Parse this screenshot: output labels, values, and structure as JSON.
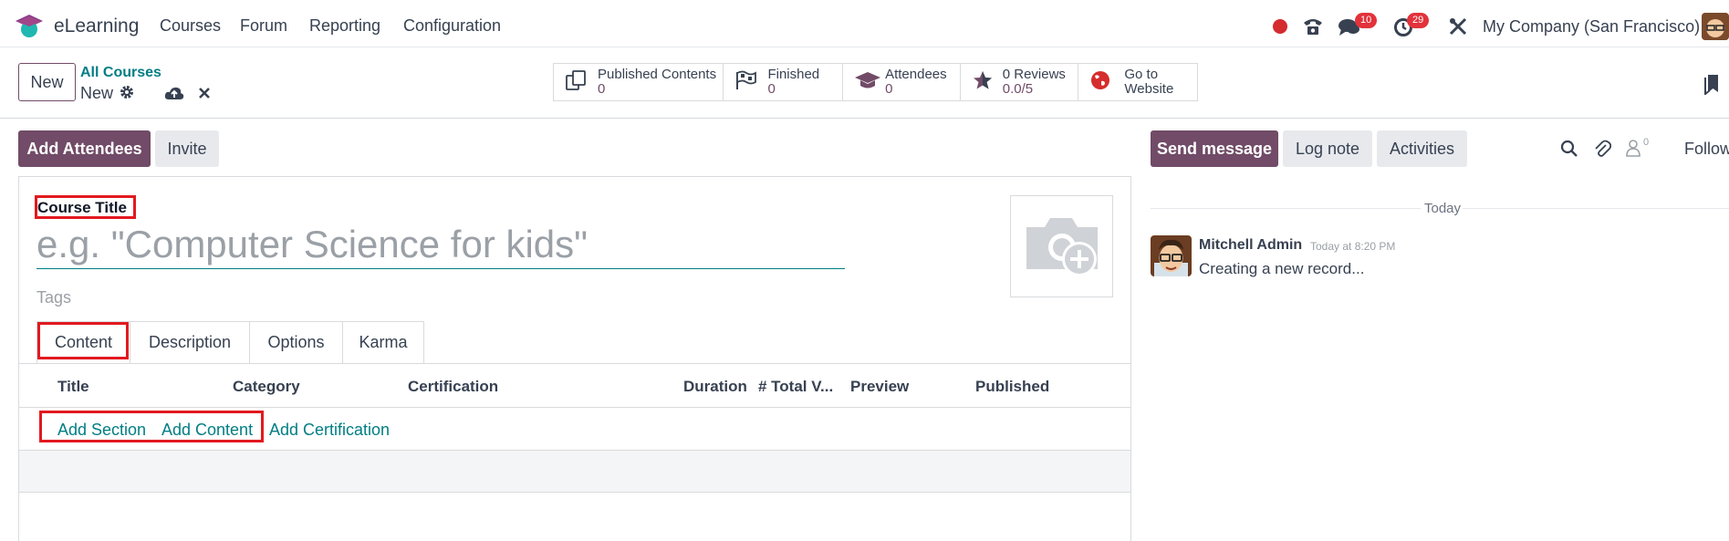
{
  "topbar": {
    "app_name": "eLearning",
    "menus": [
      "Courses",
      "Forum",
      "Reporting",
      "Configuration"
    ],
    "messages_count": "10",
    "activities_count": "29",
    "company": "My Company (San Francisco)"
  },
  "control_panel": {
    "new_label": "New",
    "breadcrumb_parent": "All Courses",
    "breadcrumb_current": "New",
    "stats": [
      {
        "label": "Published Contents",
        "value": "0",
        "icon": "copy-icon"
      },
      {
        "label": "Finished",
        "value": "0",
        "icon": "flag-icon"
      },
      {
        "label": "Attendees",
        "value": "0",
        "icon": "graduation-cap-icon"
      },
      {
        "label": "0 Reviews",
        "value": "0.0/5",
        "icon": "star-icon"
      },
      {
        "label": "Go to",
        "value": "Website",
        "icon": "globe-icon"
      }
    ]
  },
  "actions": {
    "add_attendees": "Add Attendees",
    "invite": "Invite"
  },
  "form": {
    "title_label": "Course Title",
    "title_placeholder": "e.g. \"Computer Science for kids\"",
    "tags_placeholder": "Tags",
    "tabs": [
      "Content",
      "Description",
      "Options",
      "Karma"
    ],
    "columns": [
      "Title",
      "Category",
      "Certification",
      "Duration",
      "# Total V...",
      "Preview",
      "Published"
    ],
    "links": {
      "add_section": "Add Section",
      "add_content": "Add Content",
      "add_certification": "Add Certification"
    }
  },
  "chatter": {
    "send_message": "Send message",
    "log_note": "Log note",
    "activities": "Activities",
    "followers_count": "0",
    "follow": "Follow",
    "date_separator": "Today",
    "message": {
      "author": "Mitchell Admin",
      "time": "Today at 8:20 PM",
      "body": "Creating a new record..."
    }
  },
  "colors": {
    "brand": "#714b67",
    "link": "#017e84",
    "badge": "#e2323b",
    "highlight": "#e2191f"
  }
}
